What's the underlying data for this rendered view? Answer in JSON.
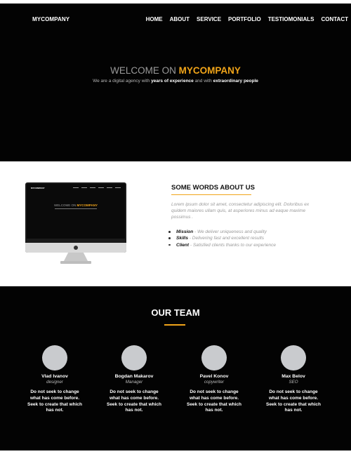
{
  "header": {
    "brand": "MYCOMPANY",
    "nav": [
      "HOME",
      "ABOUT",
      "SERVICE",
      "PORTFOLIO",
      "TESTIOMONIALS",
      "CONTACT"
    ]
  },
  "hero": {
    "title_prefix": "WELCOME ON ",
    "title_accent": "MYCOMPANY",
    "sub_1": "We are a digital agency with ",
    "sub_bold_1": "years of experience",
    "sub_2": " and with ",
    "sub_bold_2": "extraordinary people"
  },
  "about": {
    "heading": "SOME WORDS ABOUT US",
    "paragraph": "Lorem ipsum dolor sit amet, consectetur adipiscing elit. Doloribus ex quidem maiores ullam quis, at asperiores minus ad eaque maxime possimus .",
    "items": [
      {
        "label": "Mission",
        "text": " - We deliver uniqueness and quality"
      },
      {
        "label": "Skills",
        "text": " - Delivering fast and excellent results"
      },
      {
        "label": "Client",
        "text": " - Satisfied clients thanks to our experience"
      }
    ],
    "monitor": {
      "brand": "MYCOMPANY",
      "title_prefix": "WELCOME ON ",
      "title_accent": "MYCOMPANY"
    }
  },
  "team": {
    "title": "OUR TEAM",
    "members": [
      {
        "name": "Vlad Ivanov",
        "role": "designer",
        "text": "Do not seek to change what has come before. Seek to create that which has not."
      },
      {
        "name": "Bogdan Makarov",
        "role": "Manager",
        "text": "Do not seek to change what has come before. Seek to create that which has not."
      },
      {
        "name": "Pavel Konov",
        "role": "copywriter",
        "text": "Do not seek to change what has come before. Seek to create that which has not."
      },
      {
        "name": "Max Belov",
        "role": "SEO",
        "text": "Do not seek to change what has come before. Seek to create that which has not."
      }
    ]
  },
  "colors": {
    "accent": "#f0a419",
    "background_dark": "#030303",
    "avatar_placeholder": "#c9cbce"
  }
}
